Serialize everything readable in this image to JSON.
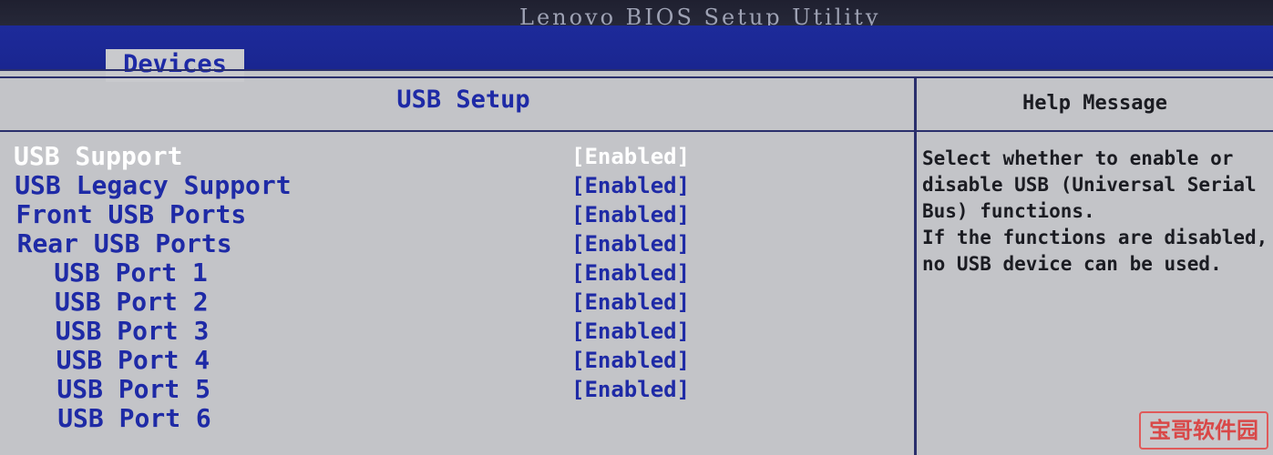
{
  "app": {
    "title": "Lenovo BIOS Setup Utility"
  },
  "menu": {
    "active_tab": "Devices"
  },
  "panel": {
    "title": "USB Setup"
  },
  "settings": [
    {
      "label": "USB Support",
      "value": "[Enabled]",
      "selected": true,
      "indent": 0
    },
    {
      "label": "USB Legacy Support",
      "value": "[Enabled]",
      "selected": false,
      "indent": 0
    },
    {
      "label": "Front USB Ports",
      "value": "[Enabled]",
      "selected": false,
      "indent": 0
    },
    {
      "label": "Rear USB Ports",
      "value": "[Enabled]",
      "selected": false,
      "indent": 0
    },
    {
      "label": "USB Port 1",
      "value": "[Enabled]",
      "selected": false,
      "indent": 1
    },
    {
      "label": "USB Port 2",
      "value": "[Enabled]",
      "selected": false,
      "indent": 1
    },
    {
      "label": "USB Port 3",
      "value": "[Enabled]",
      "selected": false,
      "indent": 1
    },
    {
      "label": "USB Port 4",
      "value": "[Enabled]",
      "selected": false,
      "indent": 1
    },
    {
      "label": "USB Port 5",
      "value": "[Enabled]",
      "selected": false,
      "indent": 1
    },
    {
      "label": "USB Port 6",
      "value": "",
      "selected": false,
      "indent": 1
    }
  ],
  "help": {
    "title": "Help Message",
    "lines": [
      "Select whether to enable or",
      "disable USB (Universal Serial",
      "Bus) functions.",
      "If the functions are disabled,",
      "no USB device can be used."
    ]
  },
  "watermark": {
    "text": "宝哥软件园"
  },
  "colors": {
    "background": "#c3c4c8",
    "menu_bar": "#1d2a9a",
    "text_blue": "#1e2aa6",
    "selected_text": "#ffffff",
    "help_text": "#1b1c22"
  }
}
